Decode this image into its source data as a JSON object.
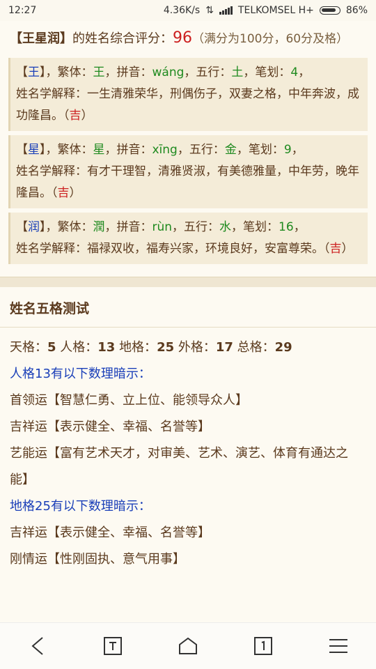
{
  "status": {
    "time": "12:27",
    "speed": "4.36K/s",
    "carrier": "TELKOMSEL H+",
    "battery": "86%"
  },
  "summary": {
    "bracket_open": "【",
    "name": "王星润",
    "bracket_close": "】",
    "text": "的姓名综合评分：",
    "score": "96",
    "note": "（满分为100分，60分及格）"
  },
  "chars": [
    {
      "char": "王",
      "trad": "王",
      "pinyin": "wáng",
      "element": "土",
      "strokes": "4",
      "meaning": "一生清雅荣华，刑偶伤子，双妻之格，中年奔波，成功隆昌。",
      "luck": "吉"
    },
    {
      "char": "星",
      "trad": "星",
      "pinyin": "xīng",
      "element": "金",
      "strokes": "9",
      "meaning": "有才干理智，清雅贤淑，有美德雅量，中年劳，晚年隆昌。",
      "luck": "吉"
    },
    {
      "char": "润",
      "trad": "潤",
      "pinyin": "rùn",
      "element": "水",
      "strokes": "16",
      "meaning": "福禄双收，福寿兴家，环境良好，安富尊荣。",
      "luck": "吉"
    }
  ],
  "labels": {
    "trad": "，繁体：",
    "pinyin": "，拼音：",
    "element": "，五行：",
    "strokes": "，笔划：",
    "meaning": "姓名学解释：",
    "luck_open": "（",
    "luck_close": "）"
  },
  "section_title": "姓名五格测试",
  "five_grids": [
    {
      "label": "天格：",
      "value": "5"
    },
    {
      "label": "人格：",
      "value": "13"
    },
    {
      "label": "地格：",
      "value": "25"
    },
    {
      "label": "外格：",
      "value": "17"
    },
    {
      "label": "总格：",
      "value": "29"
    }
  ],
  "renge_hint": "人格13有以下数理暗示：",
  "renge_items": [
    "首领运【智慧仁勇、立上位、能领导众人】",
    "吉祥运【表示健全、幸福、名誉等】",
    "艺能运【富有艺术天才，对审美、艺术、演艺、体育有通达之能】"
  ],
  "dige_hint": "地格25有以下数理暗示：",
  "dige_items": [
    "吉祥运【表示健全、幸福、名誉等】",
    "刚情运【性刚固执、意气用事】"
  ],
  "nav": [
    "back",
    "tab",
    "home",
    "pages",
    "menu"
  ]
}
